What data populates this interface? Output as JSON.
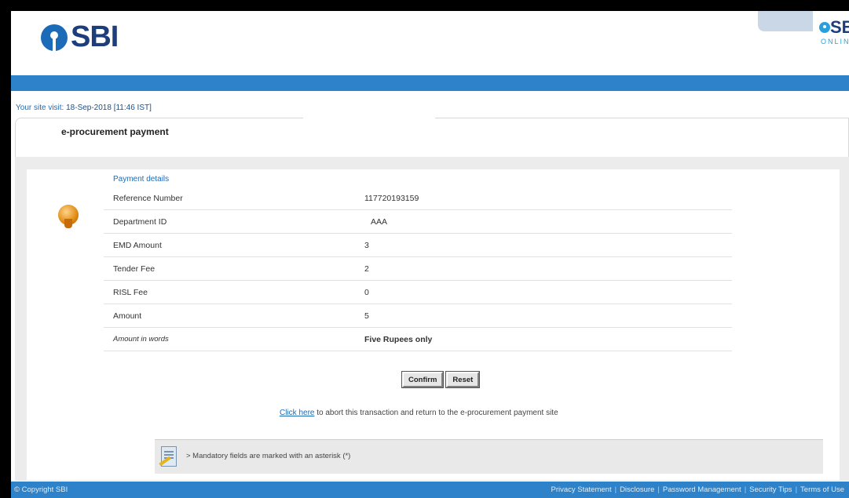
{
  "header": {
    "logo_text": "SBI",
    "online_logo_text": "SBI",
    "online_logo_sub": "ONLINE"
  },
  "last_visit": {
    "label": "Your site visit:",
    "value": "18-Sep-2018 [11:46 IST]"
  },
  "page": {
    "title": "e-procurement payment"
  },
  "payment": {
    "caption": "Payment details",
    "rows": [
      {
        "label": "Reference Number",
        "value": "117720193159"
      },
      {
        "label": "Department ID",
        "value": "AAA"
      },
      {
        "label": "EMD Amount",
        "value": "3"
      },
      {
        "label": "Tender Fee",
        "value": "2"
      },
      {
        "label": "RISL Fee",
        "value": "0"
      },
      {
        "label": "Amount",
        "value": "5"
      }
    ],
    "words_label": "Amount in words",
    "words_value": "Five Rupees only"
  },
  "buttons": {
    "confirm": "Confirm",
    "reset": "Reset"
  },
  "abort": {
    "link": "Click here",
    "text": " to abort this transaction and return to the e-procurement payment site"
  },
  "note": {
    "text": "> Mandatory fields are marked with an asterisk (*)"
  },
  "footer": {
    "copyright": "© Copyright SBI",
    "links": [
      "Privacy Statement",
      "Disclosure",
      "Password Management",
      "Security Tips",
      "Terms of Use"
    ]
  },
  "colors": {
    "brand_blue": "#2d82c9",
    "logo_navy": "#1d3d7c",
    "link_blue": "#1c6bb8"
  }
}
